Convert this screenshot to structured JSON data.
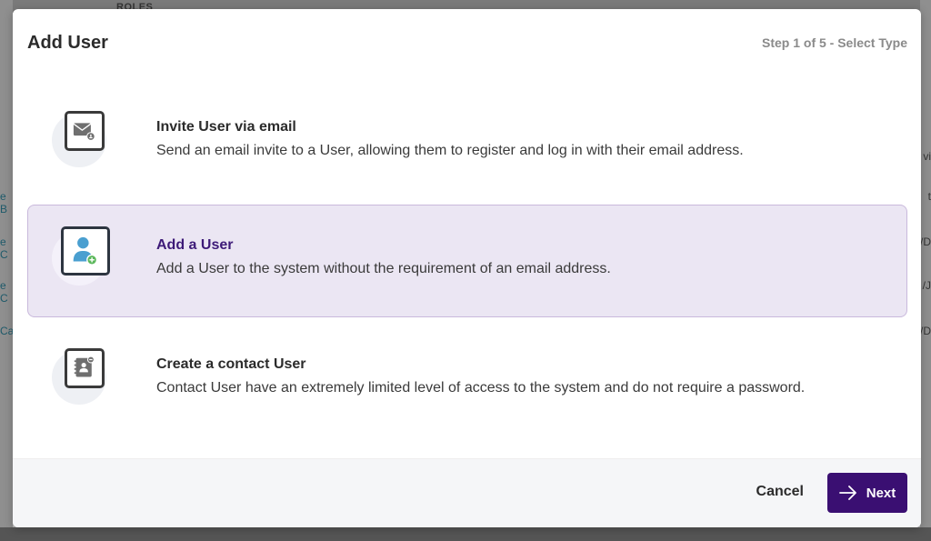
{
  "background": {
    "roles_header": "ROLES",
    "left_fragments": [
      "e B",
      "e C",
      "e C",
      "Ca"
    ],
    "right_fragments": [
      "vi",
      "t",
      "/D",
      "/J",
      "/D"
    ]
  },
  "modal": {
    "title": "Add User",
    "step": "Step 1 of 5 - Select Type"
  },
  "options": [
    {
      "title": "Invite User via email",
      "description": "Send an email invite to a User, allowing them to register and log in with their email address.",
      "icon": "envelope-icon",
      "selected": false
    },
    {
      "title": "Add a User",
      "description": "Add a User to the system without the requirement of an email address.",
      "icon": "add-user-icon",
      "selected": true
    },
    {
      "title": "Create a contact User",
      "description": "Contact User have an extremely limited level of access to the system and do not require a password.",
      "icon": "contact-book-icon",
      "selected": false
    }
  ],
  "footer": {
    "cancel_label": "Cancel",
    "next_label": "Next"
  },
  "colors": {
    "primary": "#3a0f72",
    "selected_bg": "#ebe6f3",
    "selected_border": "#c9b9dc",
    "selected_title": "#3d1a78",
    "user_icon_blue": "#4a9fd0",
    "add_badge_green": "#5cb85c"
  }
}
